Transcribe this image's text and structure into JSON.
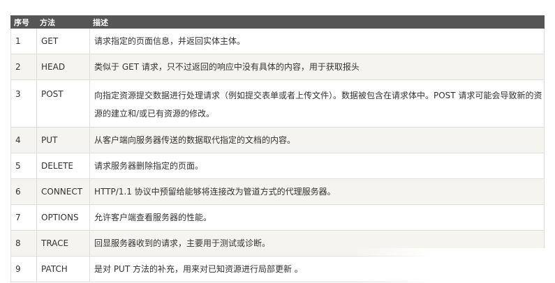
{
  "table": {
    "headers": [
      "序号",
      "方法",
      "描述"
    ],
    "rows": [
      {
        "num": "1",
        "method": "GET",
        "desc": "请求指定的页面信息，并返回实体主体。"
      },
      {
        "num": "2",
        "method": "HEAD",
        "desc": "类似于 GET 请求，只不过返回的响应中没有具体的内容，用于获取报头"
      },
      {
        "num": "3",
        "method": "POST",
        "desc": "向指定资源提交数据进行处理请求（例如提交表单或者上传文件）。数据被包含在请求体中。POST 请求可能会导致新的资源的建立和/或已有资源的修改。"
      },
      {
        "num": "4",
        "method": "PUT",
        "desc": "从客户端向服务器传送的数据取代指定的文档的内容。"
      },
      {
        "num": "5",
        "method": "DELETE",
        "desc": "请求服务器删除指定的页面。"
      },
      {
        "num": "6",
        "method": "CONNECT",
        "desc": "HTTP/1.1 协议中预留给能够将连接改为管道方式的代理服务器。"
      },
      {
        "num": "7",
        "method": "OPTIONS",
        "desc": "允许客户端查看服务器的性能。"
      },
      {
        "num": "8",
        "method": "TRACE",
        "desc": "回显服务器收到的请求，主要用于测试或诊断。"
      },
      {
        "num": "9",
        "method": "PATCH",
        "desc": "是对 PUT 方法的补充，用来对已知资源进行局部更新 。"
      }
    ]
  }
}
